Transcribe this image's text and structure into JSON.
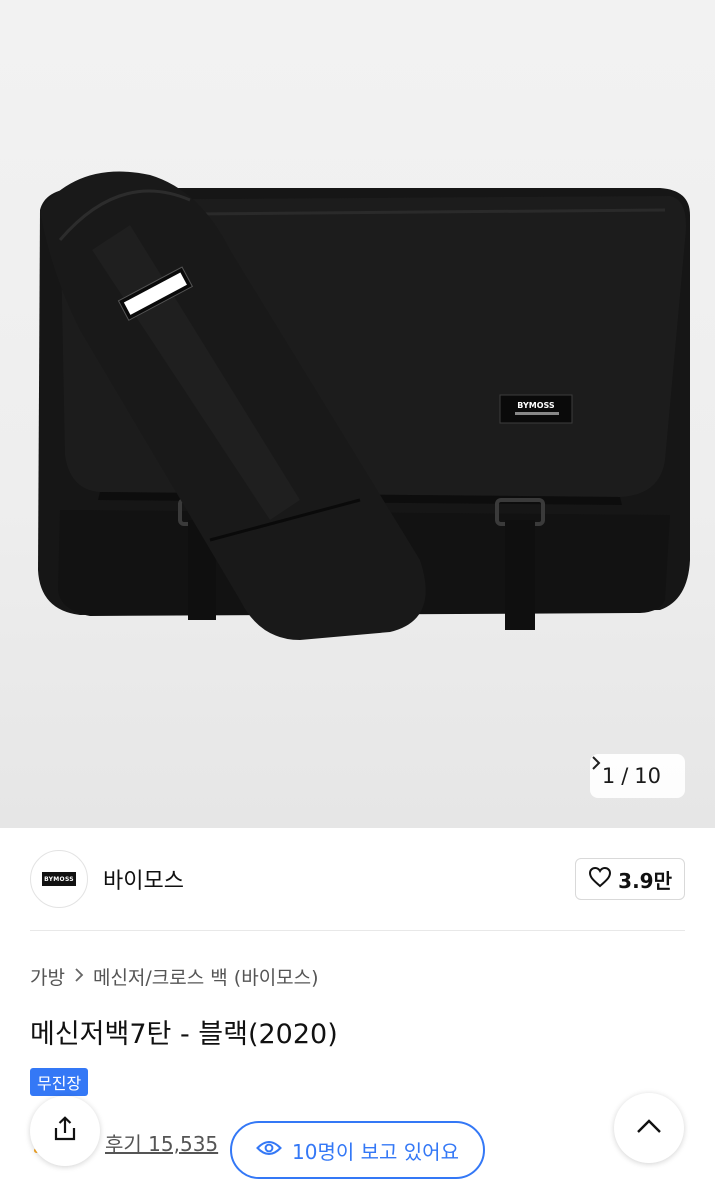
{
  "hero": {
    "counter_current": "1",
    "counter_separator": "/",
    "counter_total": "10",
    "product_label_text": "BYMOSS"
  },
  "brand": {
    "name": "바이모스",
    "logo_text": "BYMOSS",
    "likes": "3.9만"
  },
  "breadcrumb": {
    "items": [
      "가방",
      "메신저/크로스 백 (바이모스)"
    ]
  },
  "product": {
    "title": "메신저백7탄 - 블랙(2020)",
    "badge": "무진장",
    "review": "후기 15,535",
    "viewers": "10명이 보고 있어요"
  },
  "colors": {
    "accent": "#3478f6",
    "bag": "#151515"
  },
  "icons": {
    "like": "heart-icon",
    "share": "share-icon",
    "top": "chevron-up-icon",
    "viewers": "eye-icon",
    "next": "chevron-right-icon",
    "breadcrumb_sep": "chevron-right-icon"
  }
}
